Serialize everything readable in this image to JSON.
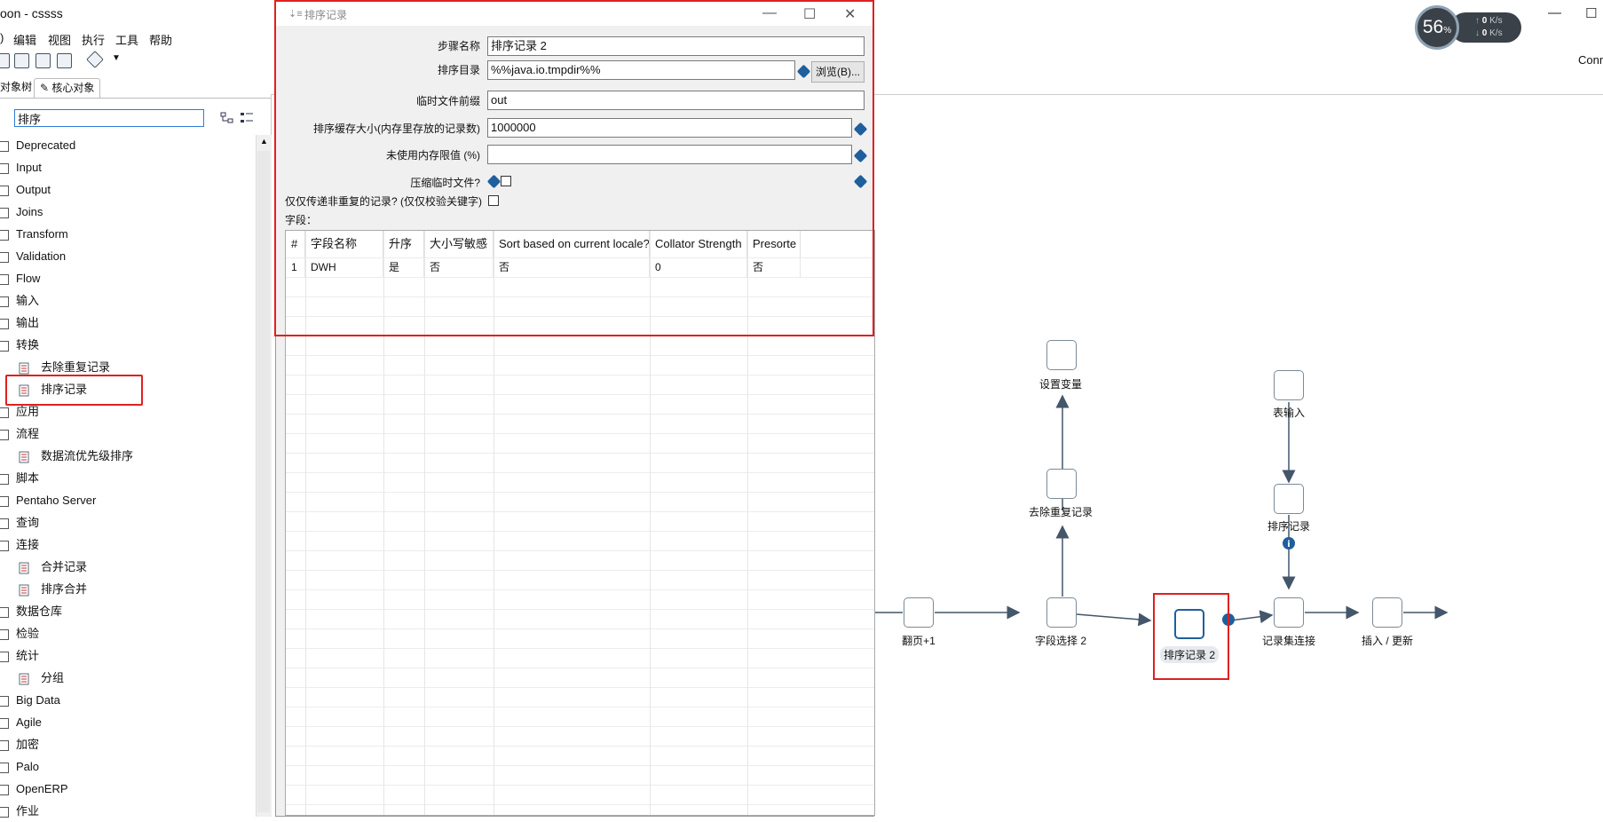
{
  "app": {
    "title": "oon - cssss"
  },
  "menu": [
    "编辑",
    "视图",
    "执行",
    "工具",
    "帮助"
  ],
  "top_right": {
    "conn_label": "Conn"
  },
  "speed_widget": {
    "percent": "56",
    "unit": "%",
    "up": "0",
    "down": "0",
    "rate_unit": "K/s"
  },
  "left_panel": {
    "tabs": {
      "tree_tab": "对象树",
      "core_tab": "核心对象"
    },
    "search_value": "排序",
    "tree": [
      {
        "label": "Deprecated",
        "type": "folder"
      },
      {
        "label": "Input",
        "type": "folder"
      },
      {
        "label": "Output",
        "type": "folder"
      },
      {
        "label": "Joins",
        "type": "folder"
      },
      {
        "label": "Transform",
        "type": "folder"
      },
      {
        "label": "Validation",
        "type": "folder"
      },
      {
        "label": "Flow",
        "type": "folder"
      },
      {
        "label": "输入",
        "type": "folder"
      },
      {
        "label": "输出",
        "type": "folder"
      },
      {
        "label": "转换",
        "type": "folder"
      },
      {
        "label": "去除重复记录",
        "type": "leaf"
      },
      {
        "label": "排序记录",
        "type": "leaf"
      },
      {
        "label": "应用",
        "type": "folder"
      },
      {
        "label": "流程",
        "type": "folder"
      },
      {
        "label": "数据流优先级排序",
        "type": "leaf"
      },
      {
        "label": "脚本",
        "type": "folder"
      },
      {
        "label": "Pentaho Server",
        "type": "folder"
      },
      {
        "label": "查询",
        "type": "folder"
      },
      {
        "label": "连接",
        "type": "folder"
      },
      {
        "label": "合并记录",
        "type": "leaf"
      },
      {
        "label": "排序合并",
        "type": "leaf"
      },
      {
        "label": "数据仓库",
        "type": "folder"
      },
      {
        "label": "检验",
        "type": "folder"
      },
      {
        "label": "统计",
        "type": "folder"
      },
      {
        "label": "分组",
        "type": "leaf"
      },
      {
        "label": "Big Data",
        "type": "folder"
      },
      {
        "label": "Agile",
        "type": "folder"
      },
      {
        "label": "加密",
        "type": "folder"
      },
      {
        "label": "Palo",
        "type": "folder"
      },
      {
        "label": "OpenERP",
        "type": "folder"
      },
      {
        "label": "作业",
        "type": "folder"
      }
    ]
  },
  "dialog": {
    "title": "排序记录",
    "fields": {
      "step_name_label": "步骤名称",
      "step_name_value": "排序记录 2",
      "sort_dir_label": "排序目录",
      "sort_dir_value": "%%java.io.tmpdir%%",
      "browse_button": "浏览(B)...",
      "tmp_prefix_label": "临时文件前缀",
      "tmp_prefix_value": "out",
      "cache_size_label": "排序缓存大小(内存里存放的记录数)",
      "cache_size_value": "1000000",
      "free_mem_label": "未使用内存限值 (%)",
      "free_mem_value": "",
      "compress_label": "压缩临时文件?",
      "unique_label": "仅仅传递非重复的记录? (仅仅校验关键字)",
      "fields_label": "字段："
    },
    "grid": {
      "headers": [
        "#",
        "字段名称",
        "升序",
        "大小写敏感",
        "Sort based on current locale?",
        "Collator Strength",
        "Presorte"
      ],
      "rows": [
        [
          "1",
          "DWH",
          "是",
          "否",
          "否",
          "0",
          "否"
        ]
      ]
    }
  },
  "flow": {
    "steps": {
      "set_var": "设置变量",
      "dedup": "去除重复记录",
      "table_input": "表输入",
      "sort_top": "排序记录",
      "page": "翻页+1",
      "field_select": "字段选择 2",
      "sort2": "排序记录 2",
      "merge_join": "记录集连接",
      "insert_update": "插入 / 更新"
    }
  }
}
